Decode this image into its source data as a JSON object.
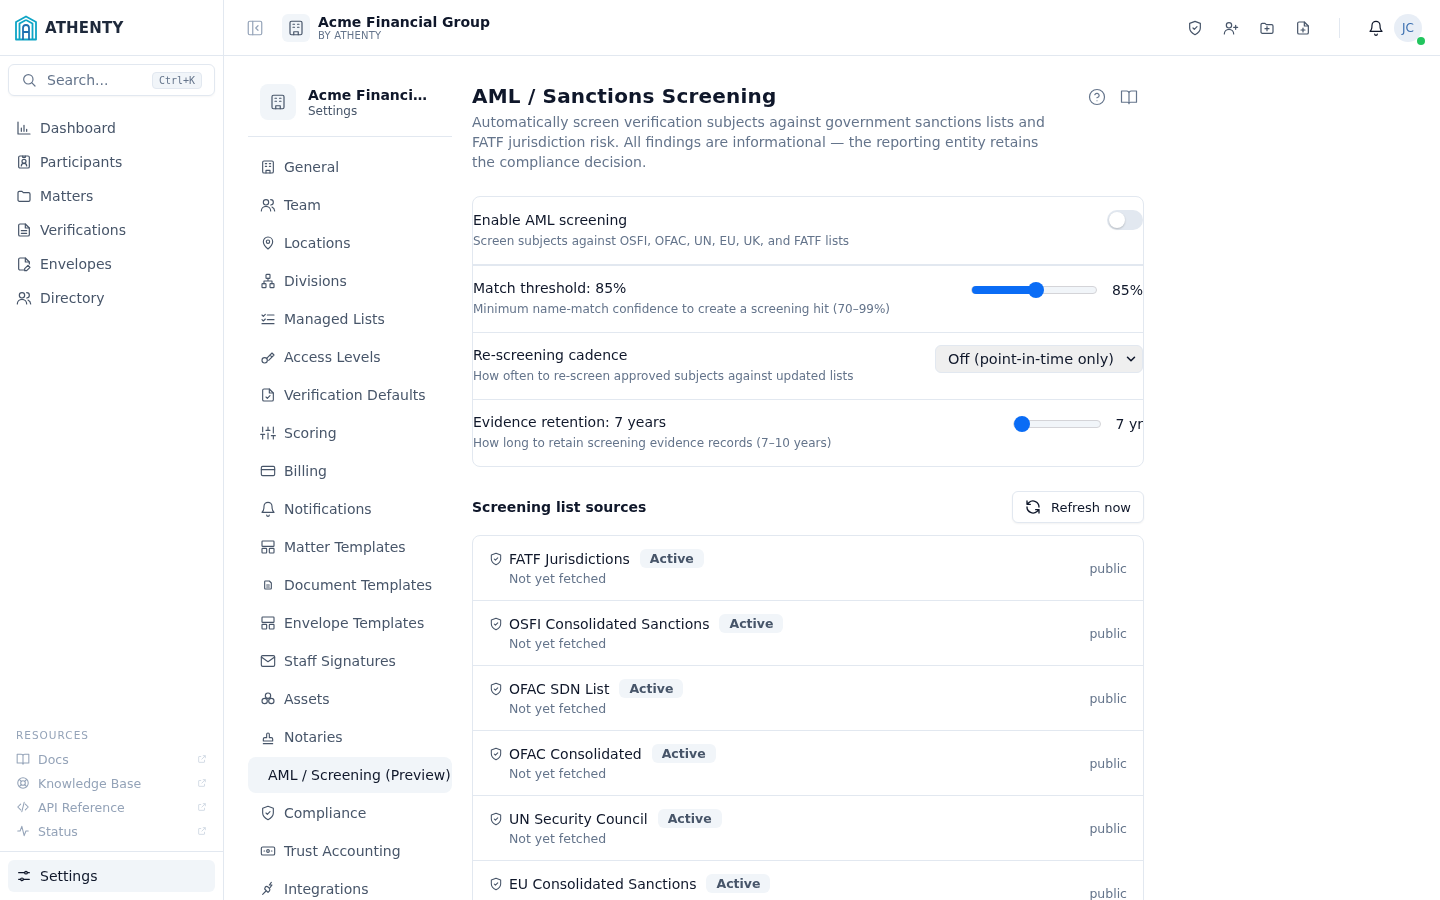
{
  "brand": {
    "name": "ATHENTY"
  },
  "search": {
    "placeholder": "Search...",
    "shortcut": "Ctrl+K"
  },
  "sidebar": {
    "items": [
      {
        "label": "Dashboard",
        "selected": false
      },
      {
        "label": "Participants",
        "selected": false
      },
      {
        "label": "Matters",
        "selected": false
      },
      {
        "label": "Verifications",
        "selected": false
      },
      {
        "label": "Envelopes",
        "selected": false
      },
      {
        "label": "Directory",
        "selected": false
      }
    ],
    "resources_heading": "RESOURCES",
    "resources": [
      {
        "label": "Docs"
      },
      {
        "label": "Knowledge Base"
      },
      {
        "label": "API Reference"
      },
      {
        "label": "Status"
      }
    ],
    "settings": {
      "label": "Settings",
      "selected": true
    }
  },
  "topbar": {
    "org_name": "Acme Financial Group",
    "org_sub": "BY ATHENTY",
    "avatar": "JC",
    "online": true
  },
  "settings_nav": {
    "org_name": "Acme Financi…",
    "subtitle": "Settings",
    "items": [
      {
        "label": "General",
        "selected": false
      },
      {
        "label": "Team",
        "selected": false
      },
      {
        "label": "Locations",
        "selected": false
      },
      {
        "label": "Divisions",
        "selected": false
      },
      {
        "label": "Managed Lists",
        "selected": false
      },
      {
        "label": "Access Levels",
        "selected": false
      },
      {
        "label": "Verification Defaults",
        "selected": false
      },
      {
        "label": "Scoring",
        "selected": false
      },
      {
        "label": "Billing",
        "selected": false
      },
      {
        "label": "Notifications",
        "selected": false
      },
      {
        "label": "Matter Templates",
        "selected": false
      },
      {
        "label": "Document Templates",
        "selected": false
      },
      {
        "label": "Envelope Templates",
        "selected": false
      },
      {
        "label": "Staff Signatures",
        "selected": false
      },
      {
        "label": "Assets",
        "selected": false
      },
      {
        "label": "Notaries",
        "selected": false
      },
      {
        "label": "AML / Screening (Preview)",
        "selected": true
      },
      {
        "label": "Compliance",
        "selected": false
      },
      {
        "label": "Trust Accounting",
        "selected": false
      },
      {
        "label": "Integrations",
        "selected": false
      }
    ]
  },
  "page": {
    "title": "AML / Sanctions Screening",
    "description": "Automatically screen verification subjects against government sanctions lists and FATF jurisdiction risk. All findings are informational — the reporting entity retains the compliance decision.",
    "settings": [
      {
        "kind": "toggle",
        "label": "Enable AML screening",
        "hint": "Screen subjects against OSFI, OFAC, UN, EU, UK, and FATF lists",
        "on": false
      },
      {
        "kind": "slider",
        "label": "Match threshold: 85%",
        "hint": "Minimum name-match confidence to create a screening hit (70–99%)",
        "level": 0.52,
        "reading": "85%"
      },
      {
        "kind": "select",
        "label": "Re-screening cadence",
        "hint": "How often to re-screen approved subjects against updated lists",
        "value": "Off (point-in-time only)"
      },
      {
        "kind": "slider",
        "label": "Evidence retention: 7 years",
        "hint": "How long to retain screening evidence records (7–10 years)",
        "level": 0,
        "reading": "7 yr"
      }
    ],
    "sources_heading": "Screening list sources",
    "refresh_button": "Refresh now",
    "sources": [
      {
        "name": "FATF Jurisdictions",
        "status": "Active",
        "subtitle": "Not yet fetched",
        "visibility": "public"
      },
      {
        "name": "OSFI Consolidated Sanctions",
        "status": "Active",
        "subtitle": "Not yet fetched",
        "visibility": "public"
      },
      {
        "name": "OFAC SDN List",
        "status": "Active",
        "subtitle": "Not yet fetched",
        "visibility": "public"
      },
      {
        "name": "OFAC Consolidated",
        "status": "Active",
        "subtitle": "Not yet fetched",
        "visibility": "public"
      },
      {
        "name": "UN Security Council",
        "status": "Active",
        "subtitle": "Not yet fetched",
        "visibility": "public"
      },
      {
        "name": "EU Consolidated Sanctions",
        "status": "Active",
        "visibility": "public"
      }
    ]
  }
}
